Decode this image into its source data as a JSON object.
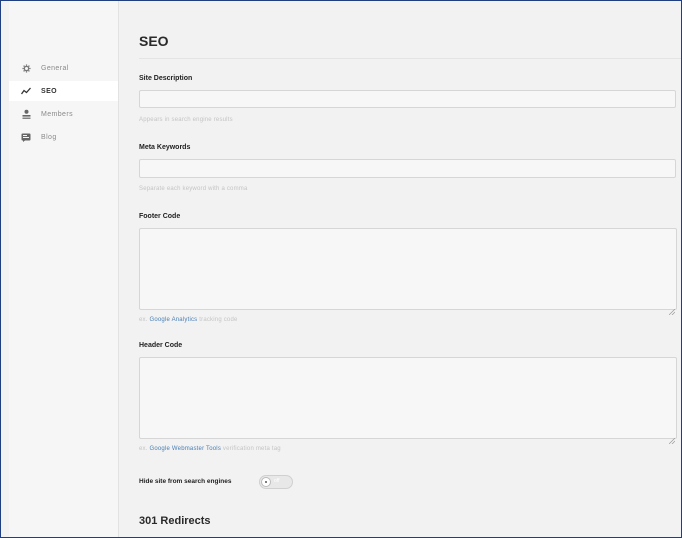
{
  "sidebar": {
    "items": [
      {
        "label": "General",
        "icon": "gear-icon",
        "active": false
      },
      {
        "label": "SEO",
        "icon": "trend-icon",
        "active": true
      },
      {
        "label": "Members",
        "icon": "user-icon",
        "active": false
      },
      {
        "label": "Blog",
        "icon": "blog-icon",
        "active": false
      }
    ]
  },
  "page": {
    "title": "SEO",
    "site_description": {
      "label": "Site Description",
      "value": "",
      "hint": "Appears in search engine results"
    },
    "meta_keywords": {
      "label": "Meta Keywords",
      "value": "",
      "hint": "Separate each keyword with a comma"
    },
    "footer_code": {
      "label": "Footer Code",
      "value": "",
      "hint_prefix": "ex. ",
      "hint_link": "Google Analytics",
      "hint_suffix": " tracking code"
    },
    "header_code": {
      "label": "Header Code",
      "value": "",
      "hint_prefix": "ex. ",
      "hint_link": "Google Webmaster Tools",
      "hint_suffix": " verification meta tag"
    },
    "hide_site": {
      "label": "Hide site from search engines",
      "toggle_text": "off",
      "enabled": false
    },
    "redirects_title": "301 Redirects"
  },
  "colors": {
    "accent_link": "#4a7fb5",
    "frame_border": "#1f3f80"
  }
}
